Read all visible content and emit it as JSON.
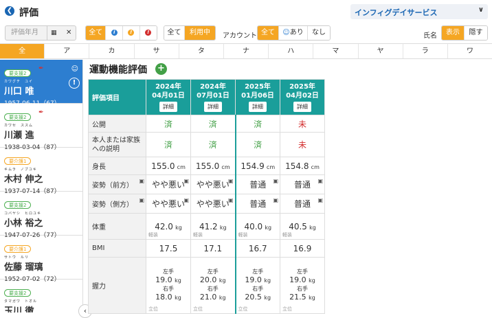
{
  "header": {
    "title": "評価",
    "office": "インフィグデイサービス"
  },
  "filters": {
    "date_placeholder": "評価年月",
    "level_all": "全て",
    "state_all": "全て",
    "state_active": "利用中",
    "account_label": "アカウント",
    "account_all": "全て",
    "account_yes": "あり",
    "account_no": "なし",
    "name_label": "氏名",
    "name_show": "表示",
    "name_hide": "隠す"
  },
  "kana": [
    "全",
    "ア",
    "カ",
    "サ",
    "タ",
    "ナ",
    "ハ",
    "マ",
    "ヤ",
    "ラ",
    "ワ"
  ],
  "people": [
    {
      "badge": "要支援2",
      "furi": "カワグチ　ユイ",
      "name": "川口 唯",
      "birth": "1957-06-11（67）"
    },
    {
      "badge": "要支援2",
      "furi": "カワセ　ススム",
      "name": "川瀬 進",
      "birth": "1938-03-04（87）"
    },
    {
      "badge": "要介護1",
      "furi": "キムラ　ノブユキ",
      "name": "木村 伸之",
      "birth": "1937-07-14（87）"
    },
    {
      "badge": "要支援2",
      "furi": "コバヤシ　ヒロユキ",
      "name": "小林 裕之",
      "birth": "1947-07-26（77）"
    },
    {
      "badge": "要介護1",
      "furi": "サトウ　ルリ",
      "name": "佐藤 瑠璃",
      "birth": "1952-07-02（72）"
    },
    {
      "badge": "要支援2",
      "furi": "タマガワ　トオル",
      "name": "玉川 徹",
      "birth": ""
    }
  ],
  "section": {
    "title": "運動機能評価",
    "add": "+"
  },
  "table": {
    "row_header": "評価項目",
    "detail": "詳細",
    "cols": [
      {
        "year": "2024年",
        "date": "04月01日"
      },
      {
        "year": "2024年",
        "date": "07月01日"
      },
      {
        "year": "2025年",
        "date": "01月06日"
      },
      {
        "year": "2025年",
        "date": "04月02日"
      }
    ],
    "rows": {
      "public": {
        "label": "公開",
        "vals": [
          "済",
          "済",
          "済",
          "未"
        ]
      },
      "explain": {
        "label": "本人または家族への説明",
        "vals": [
          "済",
          "済",
          "済",
          "未"
        ]
      },
      "height": {
        "label": "身長",
        "vals": [
          "155.0",
          "155.0",
          "154.9",
          "154.8"
        ],
        "unit": "cm"
      },
      "posture_front": {
        "label": "姿勢（前方）",
        "vals": [
          "やや悪い",
          "やや悪い",
          "普通",
          "普通"
        ]
      },
      "posture_side": {
        "label": "姿勢（側方）",
        "vals": [
          "やや悪い",
          "やや悪い",
          "普通",
          "普通"
        ]
      },
      "weight": {
        "label": "体重",
        "vals": [
          "42.0",
          "41.2",
          "40.0",
          "40.5"
        ],
        "unit": "kg",
        "note": "軽装"
      },
      "bmi": {
        "label": "BMI",
        "vals": [
          "17.5",
          "17.1",
          "16.7",
          "16.9"
        ]
      },
      "grip": {
        "label": "握力",
        "left": "左手",
        "right": "右手",
        "unit": "kg",
        "note": "立位",
        "l": [
          "19.0",
          "20.0",
          "19.0",
          "19.0"
        ],
        "r": [
          "18.0",
          "21.0",
          "20.5",
          "21.5"
        ]
      }
    }
  }
}
